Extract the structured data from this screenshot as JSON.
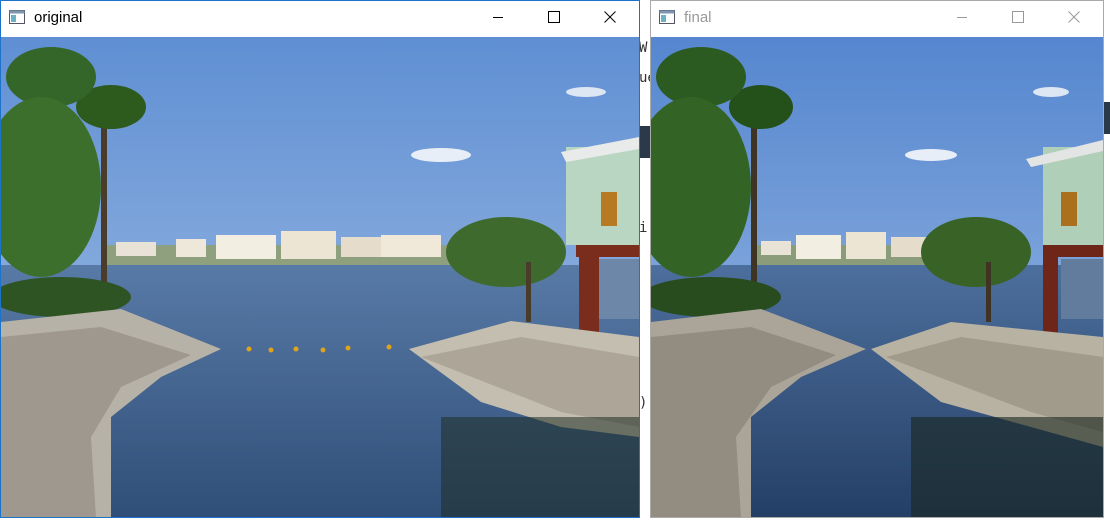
{
  "windows": [
    {
      "id": "original",
      "title": "original",
      "active": true,
      "buttons": [
        "minimize-icon",
        "maximize-icon",
        "close-icon"
      ]
    },
    {
      "id": "final",
      "title": "final",
      "active": false,
      "buttons": [
        "minimize-icon",
        "maximize-icon",
        "close-icon"
      ]
    }
  ],
  "background_window": {
    "fragments": [
      "W",
      "ue",
      "i",
      ")"
    ]
  },
  "colors": {
    "active_border": "#1d73c9",
    "inactive_border": "#aaaaaa",
    "sky": "#7aa3d8",
    "water": "#3d5e86"
  }
}
